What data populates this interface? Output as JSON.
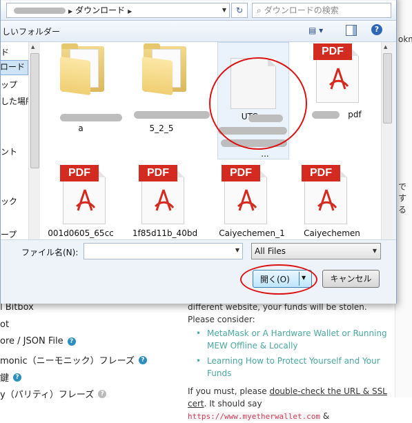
{
  "dialog": {
    "breadcrumb": "ダウンロード",
    "search_placeholder": "ダウンロードの検索",
    "new_folder": "しいフォルダー",
    "nav_items": [
      "ド",
      "ロード",
      "ップ",
      "した場所",
      "ント",
      "ック",
      "ープ"
    ],
    "files": [
      {
        "label": "a",
        "type": "folder"
      },
      {
        "label": "5_2_5",
        "type": "folder"
      },
      {
        "label": "UTC--",
        "label_tail": "...",
        "type": "blank"
      },
      {
        "label": "pdf",
        "type": "pdf"
      },
      {
        "label": "001d0605_65cc",
        "type": "pdf"
      },
      {
        "label": "1f85d11b_40bd",
        "type": "pdf"
      },
      {
        "label": "Caiyechemen_1",
        "type": "pdf"
      },
      {
        "label": "Caiyechemen",
        "type": "pdf"
      }
    ],
    "pdf_badge": "PDF",
    "filename_label": "ファイル名(N):",
    "filename_value": "",
    "filter": "All Files",
    "open_label": "開く(O)",
    "cancel_label": "キャンセル"
  },
  "background": {
    "left_items": [
      {
        "label": "l Bitbox",
        "help": false
      },
      {
        "label": "ot",
        "help": false
      },
      {
        "label": "ore / JSON File",
        "help": true
      },
      {
        "label": "monic（ニーモニック）フレーズ",
        "help": true
      },
      {
        "label": "鍵",
        "help": true
      },
      {
        "label": "y（パリティ）フレーズ",
        "help": true
      }
    ],
    "warning_text": "different website, your funds will be stolen. Please consider:",
    "links": [
      "MetaMask or A Hardware Wallet or Running MEW Offline & Locally",
      "Learning How to Protect Yourself and Your Funds"
    ],
    "check_prefix": "If you must, please ",
    "check_link": "double-check the URL & SSL cert",
    "check_suffix": ". It should say ",
    "url": "https://www.myetherwallet.com",
    "url_suffix": " &",
    "right_strip": [
      "okm",
      "で",
      "する"
    ]
  }
}
